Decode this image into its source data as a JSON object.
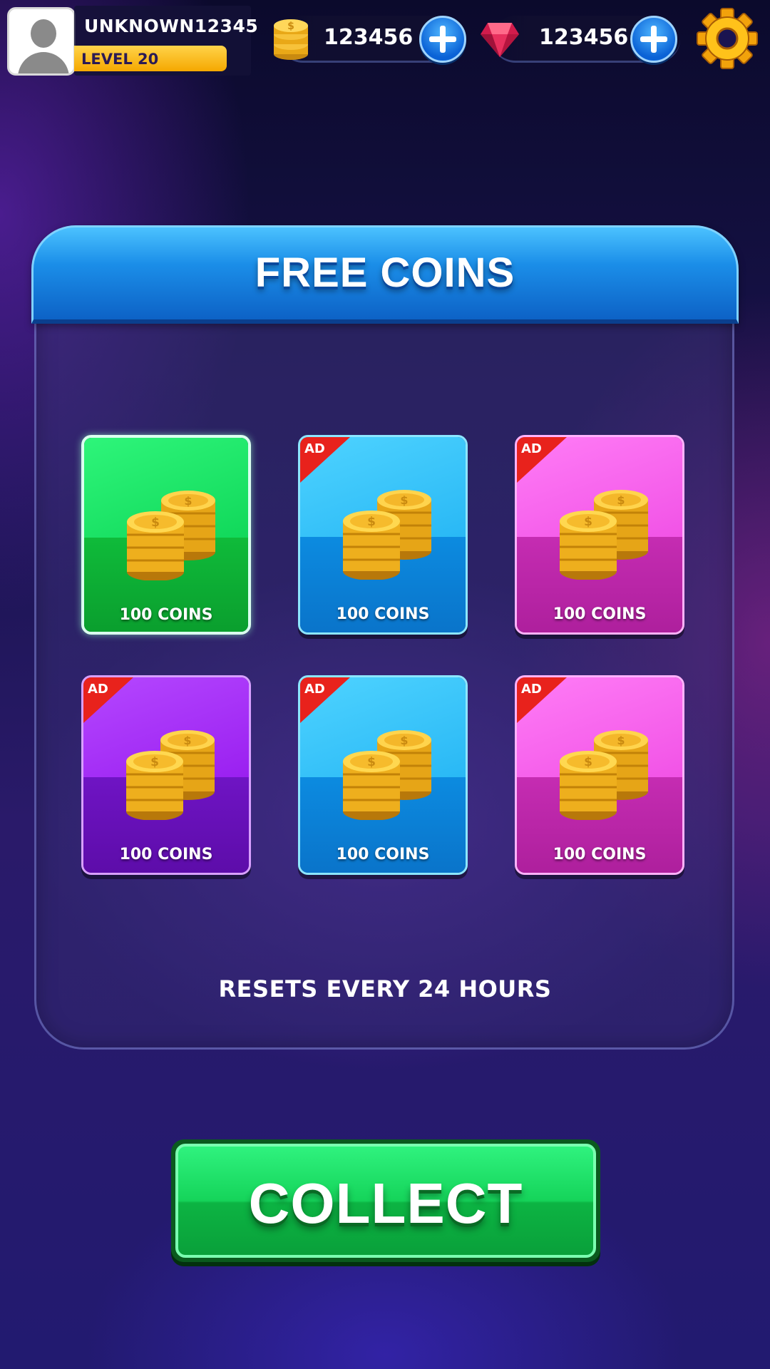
{
  "player": {
    "username": "UNKNOWN12345",
    "level_label": "LEVEL 20"
  },
  "currencies": {
    "coins": "123456",
    "gems": "123456"
  },
  "panel": {
    "title": "FREE COINS",
    "reset_note": "RESETS EVERY 24 HOURS"
  },
  "rewards": [
    {
      "label": "100 COINS",
      "color": "green",
      "ad": false,
      "ad_label": ""
    },
    {
      "label": "100 COINS",
      "color": "blue",
      "ad": true,
      "ad_label": "AD"
    },
    {
      "label": "100 COINS",
      "color": "pink",
      "ad": true,
      "ad_label": "AD"
    },
    {
      "label": "100 COINS",
      "color": "purple",
      "ad": true,
      "ad_label": "AD"
    },
    {
      "label": "100 COINS",
      "color": "blue",
      "ad": true,
      "ad_label": "AD"
    },
    {
      "label": "100 COINS",
      "color": "pink",
      "ad": true,
      "ad_label": "AD"
    }
  ],
  "collect_button": {
    "label": "COLLECT"
  },
  "icons": {
    "avatar": "avatar-placeholder-icon",
    "coin": "coin-stack-icon",
    "gem": "gem-icon",
    "plus": "plus-icon",
    "settings": "gear-icon"
  },
  "colors": {
    "accent_blue": "#1b8ee8",
    "collect_green": "#15d45a",
    "level_bar": "#f5a800",
    "ad_badge": "#e8221c"
  }
}
